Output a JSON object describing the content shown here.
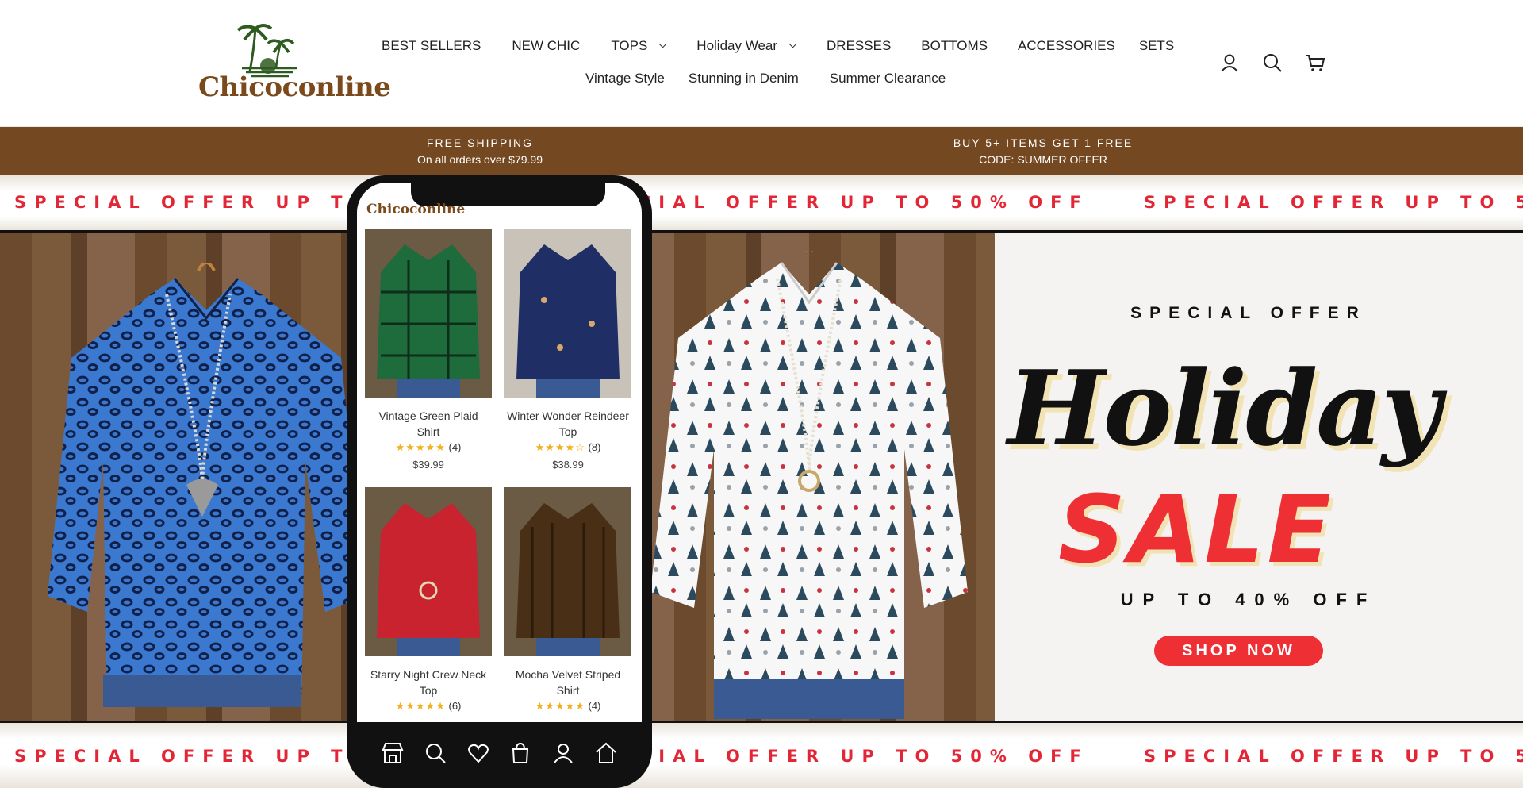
{
  "brand": {
    "logo_text": "Chicoconline"
  },
  "nav": {
    "row1": [
      {
        "label": "BEST SELLERS",
        "dropdown": false
      },
      {
        "label": "NEW CHIC",
        "dropdown": false
      },
      {
        "label": "TOPS",
        "dropdown": true
      },
      {
        "label": "Holiday Wear",
        "dropdown": true
      },
      {
        "label": "DRESSES",
        "dropdown": false
      },
      {
        "label": "BOTTOMS",
        "dropdown": false
      },
      {
        "label": "ACCESSORIES",
        "dropdown": false
      },
      {
        "label": "SETS",
        "dropdown": false
      }
    ],
    "row2": [
      {
        "label": "Vintage Style"
      },
      {
        "label": "Stunning in Denim"
      },
      {
        "label": "Summer Clearance"
      }
    ],
    "icons": [
      "account-icon",
      "search-icon",
      "cart-icon"
    ]
  },
  "promo": {
    "left_title": "FREE SHIPPING",
    "left_sub": "On all orders over $79.99",
    "right_title": "BUY 5+ ITEMS GET 1 FREE",
    "right_sub": "CODE: SUMMER OFFER"
  },
  "hero": {
    "ticker": "SPECIAL OFFER UP TO 50% OFF",
    "special_offer": "SPECIAL OFFER",
    "holiday": "Holiday",
    "sale": "SALE",
    "up_to": "UP TO 40% OFF",
    "shop_now": "SHOP NOW",
    "colors": {
      "accent": "#ee2f34",
      "promo_bg": "#744922",
      "brand_brown": "#7a4a1c"
    }
  },
  "phone": {
    "logo": "Chicoconline",
    "products": [
      {
        "name_line1": "Vintage Green Plaid",
        "name_line2": "Shirt",
        "reviews": "(4)",
        "price": "$39.99",
        "rating": 5,
        "color": "#1e6b3c"
      },
      {
        "name_line1": "Winter Wonder Reindeer",
        "name_line2": "Top",
        "reviews": "(8)",
        "price": "$38.99",
        "rating": 4.5,
        "color": "#1f2f66"
      },
      {
        "name_line1": "Starry Night Crew Neck",
        "name_line2": "Top",
        "reviews": "(6)",
        "price": "",
        "rating": 5,
        "color": "#c8232f"
      },
      {
        "name_line1": "Mocha Velvet Striped",
        "name_line2": "Shirt",
        "reviews": "(4)",
        "price": "",
        "rating": 5,
        "color": "#4a2f17"
      }
    ],
    "nav_icons": [
      "store-icon",
      "search-icon",
      "heart-icon",
      "bag-icon",
      "user-icon",
      "home-icon"
    ]
  }
}
